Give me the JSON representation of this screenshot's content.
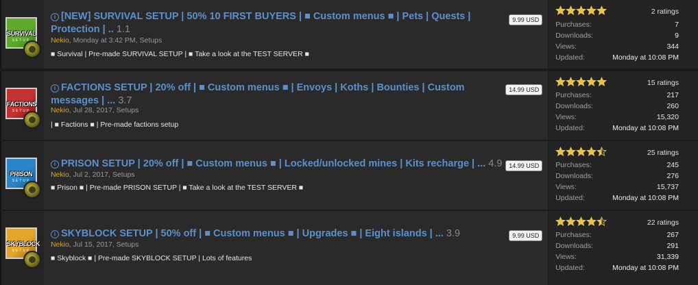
{
  "colors": {
    "link": "#5b90cc",
    "author": "#d5a42a",
    "star": "#e8c34c"
  },
  "resources": [
    {
      "icon": {
        "label": "SURVIVAL",
        "sub": "SETUP",
        "bg": "#5faa2d",
        "accent": "#3b7d19"
      },
      "title": "[NEW] SURVIVAL SETUP | 50% 10 FIRST BUYERS | ■ Custom menus ■ | Pets | Quests | Protection | ..",
      "version": "1.1",
      "price": "9.99 USD",
      "author": "Nekio",
      "date_category": ", Monday at 3:42 PM, Setups",
      "tagline": "■ Survival | Pre-made SURVIVAL SETUP | ■ Take a look at the TEST SERVER ■",
      "rating_value": 5,
      "ratings": "2 ratings",
      "purchases_label": "Purchases:",
      "purchases": "7",
      "downloads_label": "Downloads:",
      "downloads": "9",
      "views_label": "Views:",
      "views": "344",
      "updated_label": "Updated:",
      "updated": "Monday at 10:08 PM"
    },
    {
      "icon": {
        "label": "FACTIONS",
        "sub": "SETUP",
        "bg": "#c43232",
        "accent": "#7d1414"
      },
      "title": "FACTIONS SETUP | 20% off | ■ Custom menus ■ | Envoys | Koths | Bounties | Custom messages | ...",
      "version": "3.7",
      "price": "14.99 USD",
      "author": "Nekio",
      "date_category": ", Jul 28, 2017, Setups",
      "tagline": "| ■ Factions ■ | Pre-made factions setup",
      "rating_value": 5,
      "ratings": "15 ratings",
      "purchases_label": "Purchases:",
      "purchases": "217",
      "downloads_label": "Downloads:",
      "downloads": "260",
      "views_label": "Views:",
      "views": "15,320",
      "updated_label": "Updated:",
      "updated": "Monday at 10:08 PM"
    },
    {
      "icon": {
        "label": "PRISON",
        "sub": "SETUP",
        "bg": "#2a86c9",
        "accent": "#165a8c"
      },
      "title": "PRISON SETUP | 20% off | ■ Custom menus ■ | Locked/unlocked mines | Kits recharge | ...",
      "version": "4.9",
      "price": "14.99 USD",
      "author": "Nekio",
      "date_category": ", Jul 2, 2017, Setups",
      "tagline": "■ Prison ■ | Pre-made PRISON SETUP | ■ Take a look at the TEST SERVER ■",
      "rating_value": 4.5,
      "ratings": "25 ratings",
      "purchases_label": "Purchases:",
      "purchases": "245",
      "downloads_label": "Downloads:",
      "downloads": "276",
      "views_label": "Views:",
      "views": "15,737",
      "updated_label": "Updated:",
      "updated": "Monday at 10:08 PM"
    },
    {
      "icon": {
        "label": "SKYBLOCK",
        "sub": "SETUP",
        "bg": "#e1a62a",
        "accent": "#9a6a10"
      },
      "title": "SKYBLOCK SETUP | 50% off | ■ Custom menus ■ | Upgrades ■ | Eight islands | ...",
      "version": "3.9",
      "price": "9.99 USD",
      "author": "Nekio",
      "date_category": ", Jul 15, 2017, Setups",
      "tagline": "■ Skyblock ■ | Pre-made SKYBLOCK SETUP | Lots of features",
      "rating_value": 4.5,
      "ratings": "22 ratings",
      "purchases_label": "Purchases:",
      "purchases": "267",
      "downloads_label": "Downloads:",
      "downloads": "291",
      "views_label": "Views:",
      "views": "31,339",
      "updated_label": "Updated:",
      "updated": "Monday at 10:08 PM"
    }
  ]
}
